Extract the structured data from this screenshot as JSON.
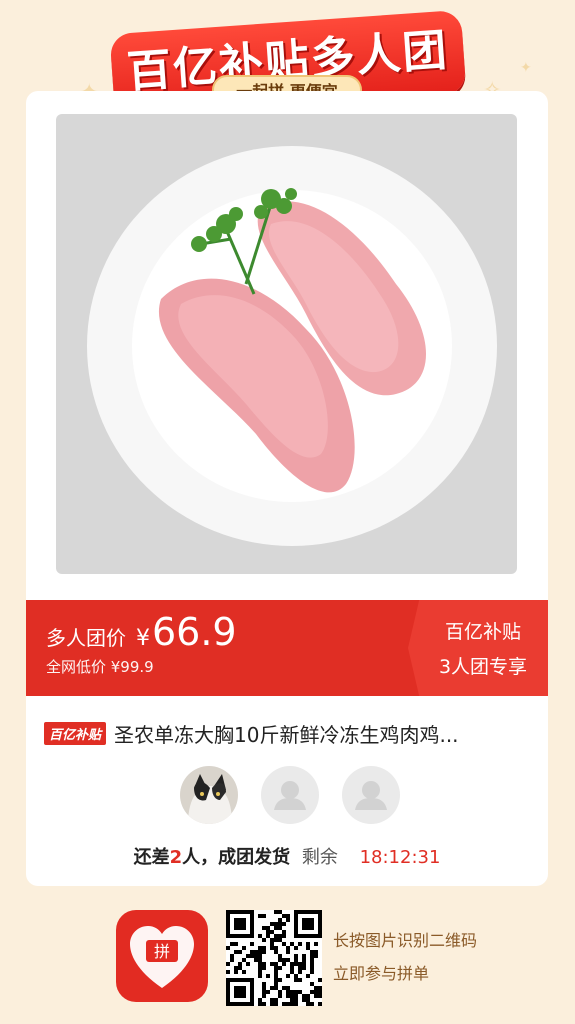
{
  "header": {
    "title": "百亿补贴多人团",
    "subtitle": "一起拼 更便宜"
  },
  "price": {
    "label": "多人团价",
    "currency": "¥",
    "value": "66.9",
    "original": "全网低价 ¥99.9"
  },
  "badge": {
    "line1": "百亿补贴",
    "line2": "3人团专享"
  },
  "product": {
    "tag": "百亿补贴",
    "title": "圣农单冻大胸10斤新鲜冷冻生鸡肉鸡..."
  },
  "group": {
    "status_prefix": "还差",
    "missing_count": "2",
    "status_suffix": "人，成团发货",
    "remaining_label": "剩余",
    "countdown": "18:12:31"
  },
  "footer": {
    "hint_line1": "长按图片识别二维码",
    "hint_line2": "立即参与拼单"
  },
  "colors": {
    "brand_red": "#e02e24",
    "background": "#fbefdc"
  }
}
